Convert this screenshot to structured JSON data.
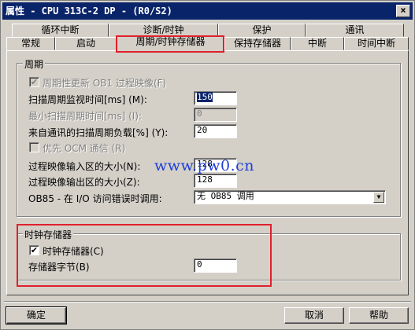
{
  "window": {
    "title": "属性 - CPU 313C-2 DP - (R0/S2)",
    "close_glyph": "×"
  },
  "tabs_back": [
    {
      "label": "循环中断"
    },
    {
      "label": "诊断/时钟"
    },
    {
      "label": "保护"
    },
    {
      "label": "通讯"
    }
  ],
  "tabs_front": [
    {
      "label": "常规"
    },
    {
      "label": "启动"
    },
    {
      "label": "周期/时钟存储器"
    },
    {
      "label": "保持存储器"
    },
    {
      "label": "中断"
    },
    {
      "label": "时间中断"
    }
  ],
  "cycle_group": {
    "title": "周期",
    "update_oi_label": "周期性更新 OB1 过程映像(F)",
    "update_oi_checked": true,
    "scan_monitor_label": "扫描周期监视时间[ms] (M):",
    "scan_monitor_value": "150",
    "min_scan_label": "最小扫描周期时间[ms] (I):",
    "min_scan_value": "0",
    "comm_load_label": "来自通讯的扫描周期负载[%] (Y):",
    "comm_load_value": "20",
    "priority_ocm_label": "优先 OCM 通信 (R)",
    "priority_ocm_checked": false,
    "pi_input_label": "过程映像输入区的大小(N):",
    "pi_input_value": "128",
    "pi_output_label": "过程映像输出区的大小(Z):",
    "pi_output_value": "128",
    "ob85_label": "OB85 - 在 I/O 访问错误时调用:",
    "ob85_value": "无 OB85 调用"
  },
  "clock_group": {
    "title": "时钟存储器",
    "clock_memory_label": "时钟存储器(C)",
    "clock_memory_checked": true,
    "memory_byte_label": "存储器字节(B)",
    "memory_byte_value": "0"
  },
  "watermark": "www.pw0.cn",
  "buttons": {
    "ok": "确定",
    "cancel": "取消",
    "help": "帮助"
  },
  "accent": {
    "highlight_box": "#e0202c",
    "title_bar": "#0a246a",
    "watermark": "#1f3fd8"
  }
}
